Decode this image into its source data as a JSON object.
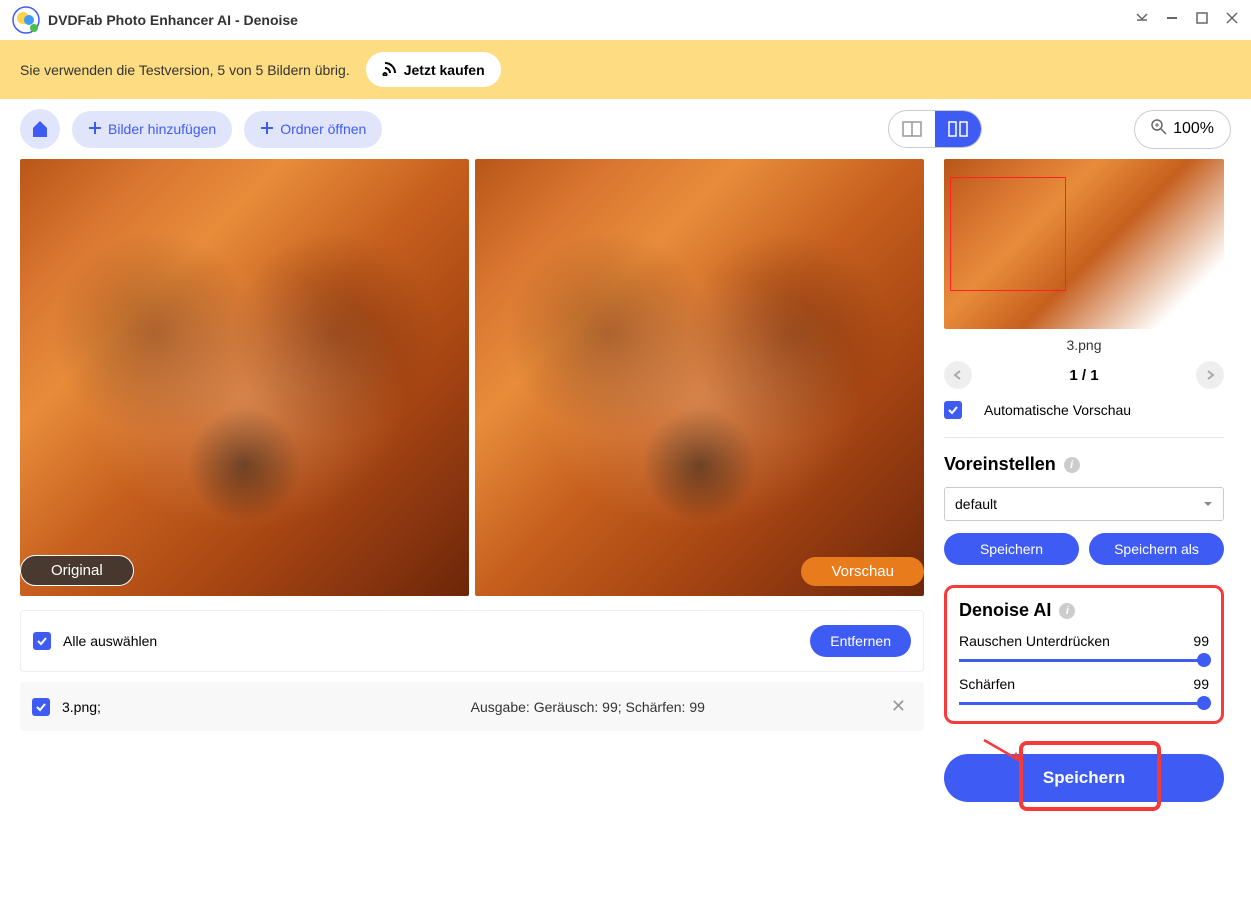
{
  "titlebar": {
    "title": "DVDFab Photo Enhancer AI - Denoise"
  },
  "banner": {
    "text": "Sie verwenden die Testversion, 5 von 5 Bildern übrig.",
    "buy_label": "Jetzt kaufen"
  },
  "toolbar": {
    "add_images": "Bilder hinzufügen",
    "open_folder": "Ordner öffnen",
    "zoom": "100%"
  },
  "compare": {
    "original_label": "Original",
    "preview_label": "Vorschau"
  },
  "list": {
    "select_all": "Alle auswählen",
    "remove": "Entfernen",
    "rows": [
      {
        "name": "3.png;",
        "output": "Ausgabe: Geräusch: 99; Schärfen: 99"
      }
    ]
  },
  "sidebar": {
    "thumb_name": "3.png",
    "page": "1 / 1",
    "auto_preview": "Automatische Vorschau",
    "preset_title": "Voreinstellen",
    "preset_value": "default",
    "save": "Speichern",
    "save_as": "Speichern als",
    "denoise_title": "Denoise AI",
    "suppress_label": "Rauschen Unterdrücken",
    "suppress_value": "99",
    "sharpen_label": "Schärfen",
    "sharpen_value": "99",
    "big_save": "Speichern"
  }
}
